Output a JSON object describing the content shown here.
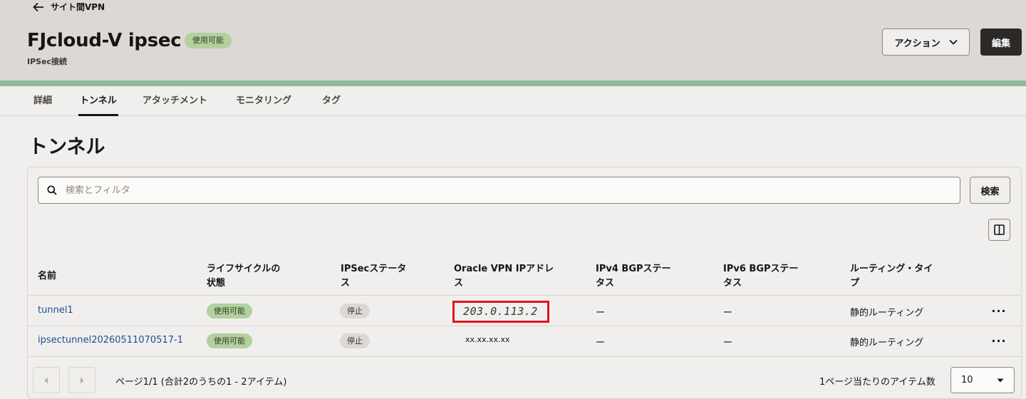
{
  "breadcrumb": {
    "back_label": "サイト間VPN"
  },
  "header": {
    "title": "FJcloud-V ipsec",
    "status_badge": "使用可能",
    "subtitle": "IPSec接続",
    "actions_label": "アクション",
    "edit_label": "編集"
  },
  "tabs": [
    {
      "label": "詳細",
      "active": false
    },
    {
      "label": "トンネル",
      "active": true
    },
    {
      "label": "アタッチメント",
      "active": false
    },
    {
      "label": "モニタリング",
      "active": false
    },
    {
      "label": "タグ",
      "active": false
    }
  ],
  "section": {
    "title": "トンネル"
  },
  "search": {
    "placeholder": "検索とフィルタ",
    "button_label": "検索"
  },
  "table": {
    "headers": {
      "name": "名前",
      "lifecycle": "ライフサイクルの|状態",
      "ipsec_status": "IPSecステータ|ス",
      "oracle_ip": "Oracle VPN IPアドレ|ス",
      "ipv4_bgp": "IPv4 BGPステー|タス",
      "ipv6_bgp": "IPv6 BGPステー|タス",
      "routing": "ルーティング・タイ|プ"
    },
    "rows": [
      {
        "name": "tunnel1",
        "lifecycle": "使用可能",
        "ipsec_status": "停止",
        "oracle_ip": "203.0.113.2",
        "ipv4_bgp": "ー",
        "ipv6_bgp": "ー",
        "routing": "静的ルーティング",
        "menu": "···"
      },
      {
        "name": "ipsectunnel20260511070517-1",
        "lifecycle": "使用可能",
        "ipsec_status": "停止",
        "oracle_ip": "xx.xx.xx.xx",
        "ipv4_bgp": "ー",
        "ipv6_bgp": "ー",
        "routing": "静的ルーティング",
        "menu": "···"
      }
    ]
  },
  "pagination": {
    "info": "ページ1/1 (合計2のうちの1 - 2アイテム)",
    "items_per_page_label": "1ページ当たりのアイテム数",
    "items_per_page_value": "10"
  },
  "colors": {
    "header_bg": "#dcd8d5",
    "accent_stripe": "#90b89c",
    "available_badge": "#b3d09f",
    "link": "#1c4e94",
    "highlight_box": "#e0131f"
  }
}
